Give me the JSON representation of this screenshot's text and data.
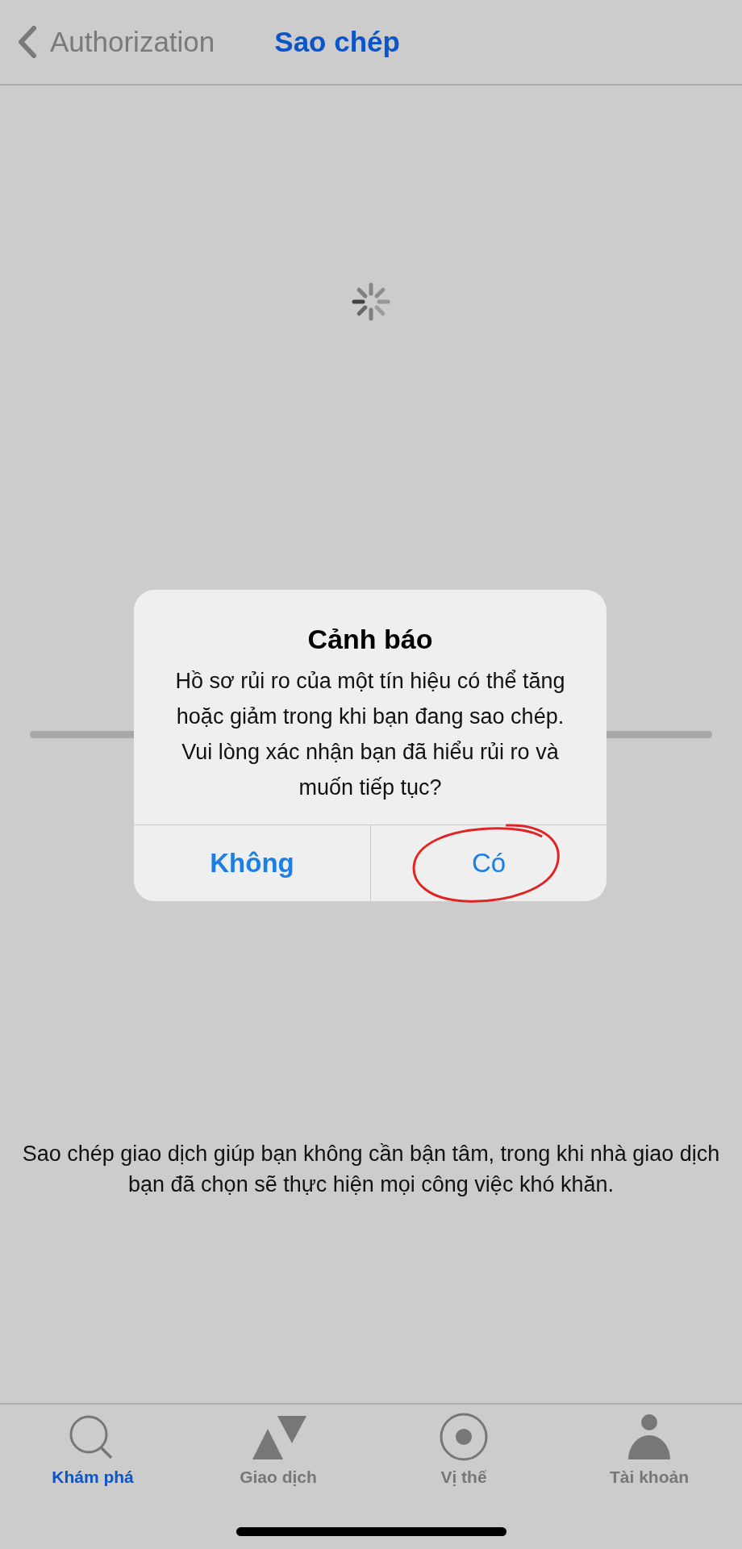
{
  "nav_bar": {
    "back_label": "Authorization",
    "title": "Sao chép"
  },
  "alert": {
    "title": "Cảnh báo",
    "message": "Hồ sơ rủi ro của một tín hiệu có thể tăng hoặc giảm trong khi bạn đang sao chép. Vui lòng xác nhận bạn đã hiểu rủi ro và muốn tiếp tục?",
    "buttons": [
      {
        "label": "Không",
        "bold": true,
        "circled": false
      },
      {
        "label": "Có",
        "bold": false,
        "circled": true
      }
    ]
  },
  "description": "Sao chép giao dịch giúp bạn không cần bận tâm, trong khi nhà giao dịch bạn đã chọn sẽ thực hiện mọi công việc khó khăn.",
  "tabs": [
    {
      "label": "Khám phá",
      "kind": "search",
      "selected": true
    },
    {
      "label": "Giao dịch",
      "kind": "trade",
      "selected": false
    },
    {
      "label": "Vị thế",
      "kind": "position",
      "selected": false
    },
    {
      "label": "Tài khoản",
      "kind": "account",
      "selected": false
    }
  ]
}
